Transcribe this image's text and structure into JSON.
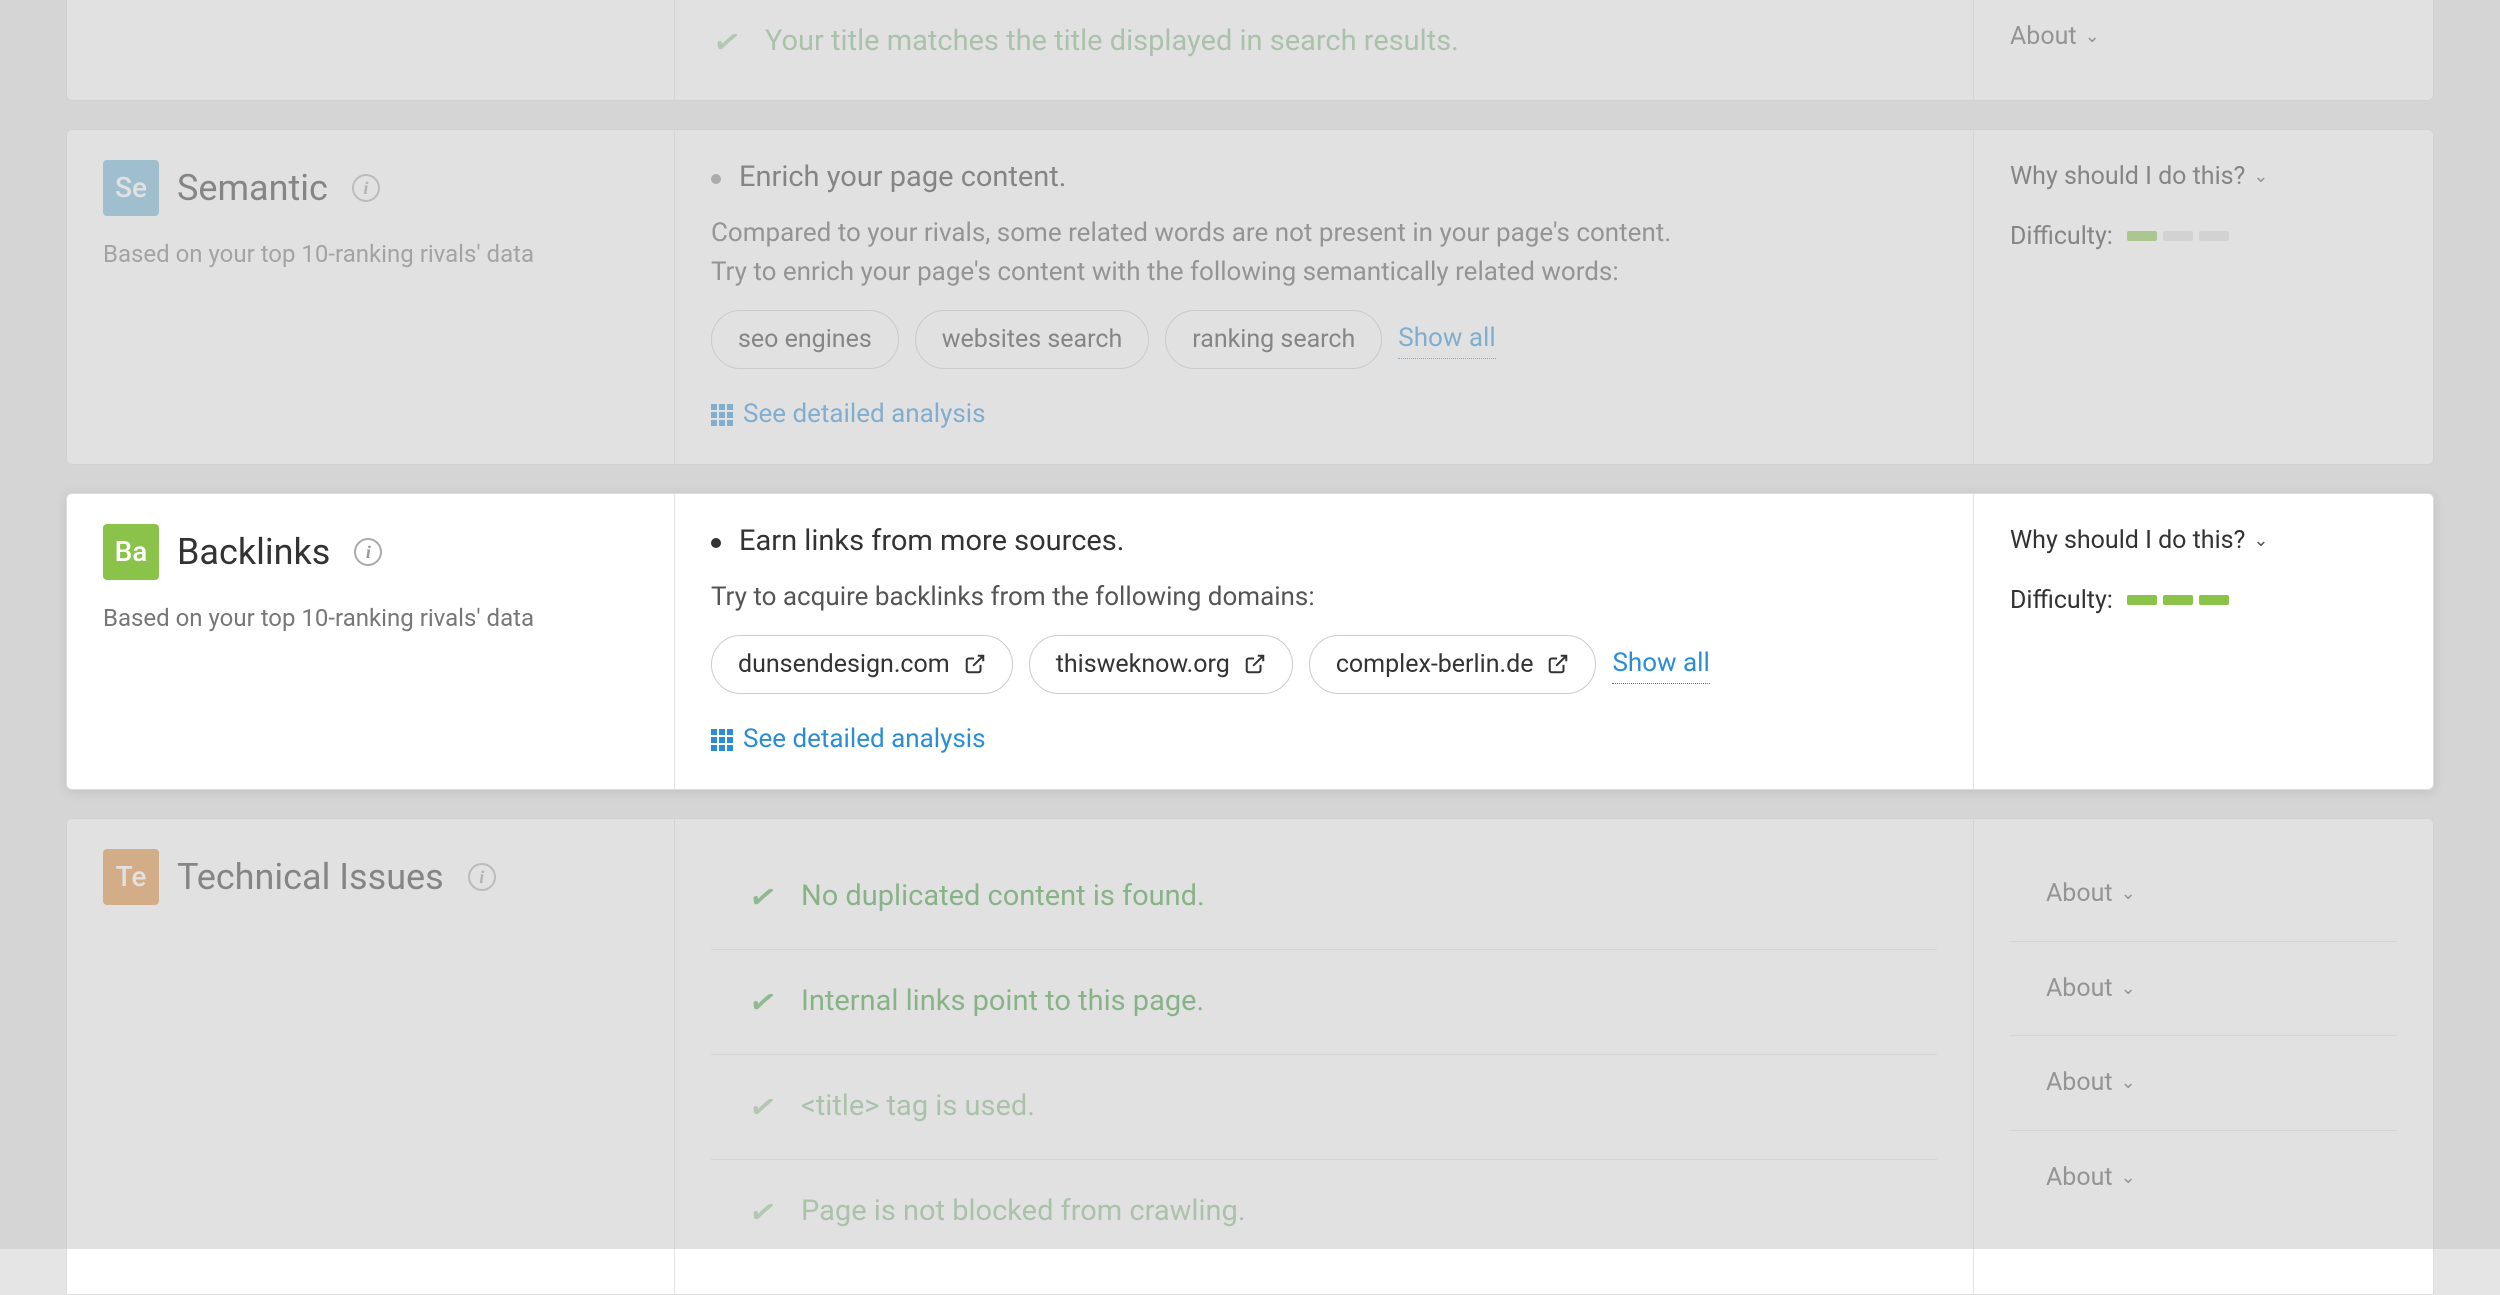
{
  "top_row": {
    "check_text": "Your title matches the title displayed in search results.",
    "about": "About"
  },
  "semantic": {
    "badge": "Se",
    "title": "Semantic",
    "subtitle": "Based on your top 10-ranking rivals' data",
    "bullet_title": "Enrich your page content.",
    "desc_line1": "Compared to your rivals, some related words are not present in your page's content.",
    "desc_line2": "Try to enrich your page's content with the following semantically related words:",
    "pills": [
      "seo engines",
      "websites search",
      "ranking search"
    ],
    "show_all": "Show all",
    "detailed": "See detailed analysis",
    "why": "Why should I do this?",
    "difficulty_label": "Difficulty:",
    "difficulty_level": 1
  },
  "backlinks": {
    "badge": "Ba",
    "title": "Backlinks",
    "subtitle": "Based on your top 10-ranking rivals' data",
    "bullet_title": "Earn links from more sources.",
    "desc": "Try to acquire backlinks from the following domains:",
    "pills": [
      "dunsendesign.com",
      "thisweknow.org",
      "complex-berlin.de"
    ],
    "show_all": "Show all",
    "detailed": "See detailed analysis",
    "why": "Why should I do this?",
    "difficulty_label": "Difficulty:",
    "difficulty_level": 3
  },
  "technical": {
    "badge": "Te",
    "title": "Technical Issues",
    "rows": [
      {
        "text": "No duplicated content is found.",
        "about": "About",
        "dim": false
      },
      {
        "text": "Internal links point to this page.",
        "about": "About",
        "dim": false
      },
      {
        "text": "<title> tag is used.",
        "about": "About",
        "dim": true
      },
      {
        "text": "Page is not blocked from crawling.",
        "about": "About",
        "dim": true
      }
    ]
  }
}
